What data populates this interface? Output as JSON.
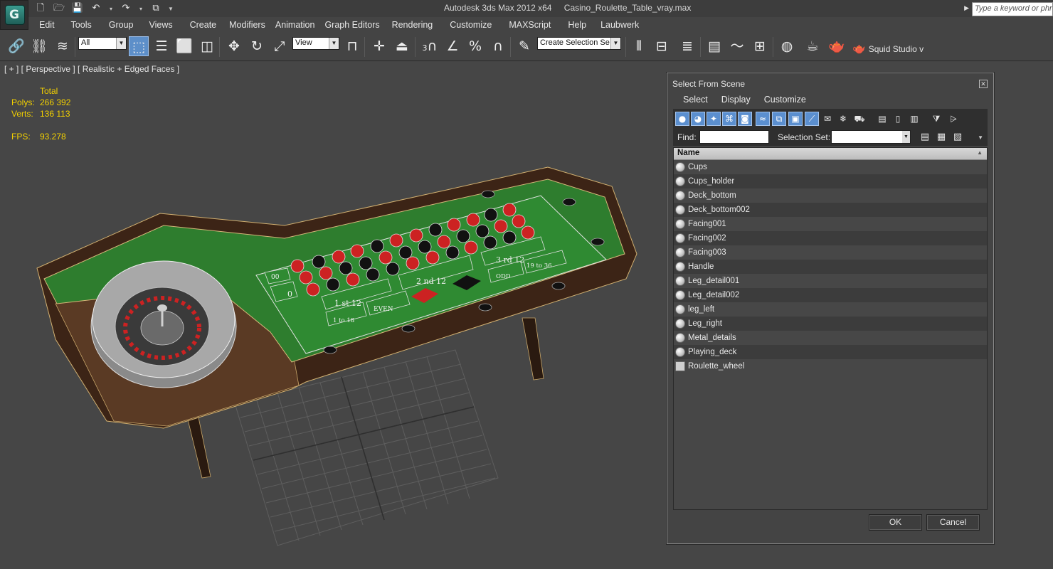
{
  "titlebar": {
    "app_name": "Autodesk 3ds Max  2012 x64",
    "file_name": "Casino_Roulette_Table_vray.max",
    "search_placeholder": "Type a keyword or phrase"
  },
  "menubar": {
    "items": [
      "Edit",
      "Tools",
      "Group",
      "Views",
      "Create",
      "Modifiers",
      "Animation",
      "Graph Editors",
      "Rendering",
      "Customize",
      "MAXScript",
      "Help",
      "Laubwerk"
    ]
  },
  "toolbar": {
    "selection_filter": "All",
    "ref_coord": "View",
    "named_selection": "Create Selection Se",
    "snap_angle_label": "3",
    "squid_label": "Squid Studio v"
  },
  "viewport": {
    "label": "[ + ] [ Perspective ] [ Realistic + Edged Faces ]",
    "stats": {
      "header": "Total",
      "polys_label": "Polys:",
      "polys_value": "266 392",
      "verts_label": "Verts:",
      "verts_value": "136 113",
      "fps_label": "FPS:",
      "fps_value": "93.278"
    },
    "table_text": {
      "first12": "1 st 12",
      "second12": "2 nd 12",
      "third12": "3 rd 12",
      "low": "1 to 18",
      "even": "EVEN",
      "odd": "ODD",
      "high": "19 to 36",
      "zero": "0",
      "double_zero": "00"
    }
  },
  "dialog": {
    "title": "Select From Scene",
    "menu": [
      "Select",
      "Display",
      "Customize"
    ],
    "find_label": "Find:",
    "find_value": "",
    "selection_set_label": "Selection Set:",
    "selection_set_value": "",
    "column_header": "Name",
    "objects": [
      "Cups",
      "Cups_holder",
      "Deck_bottom",
      "Deck_bottom002",
      "Facing001",
      "Facing002",
      "Facing003",
      "Handle",
      "Leg_detail001",
      "Leg_detail002",
      "leg_left",
      "Leg_right",
      "Metal_details",
      "Playing_deck",
      "Roulette_wheel"
    ],
    "ok_label": "OK",
    "cancel_label": "Cancel"
  },
  "colors": {
    "viewport_bg": "#464646",
    "felt": "#2e7d2e",
    "stats_text": "#f2d000",
    "active_button": "#5d8fc9"
  }
}
